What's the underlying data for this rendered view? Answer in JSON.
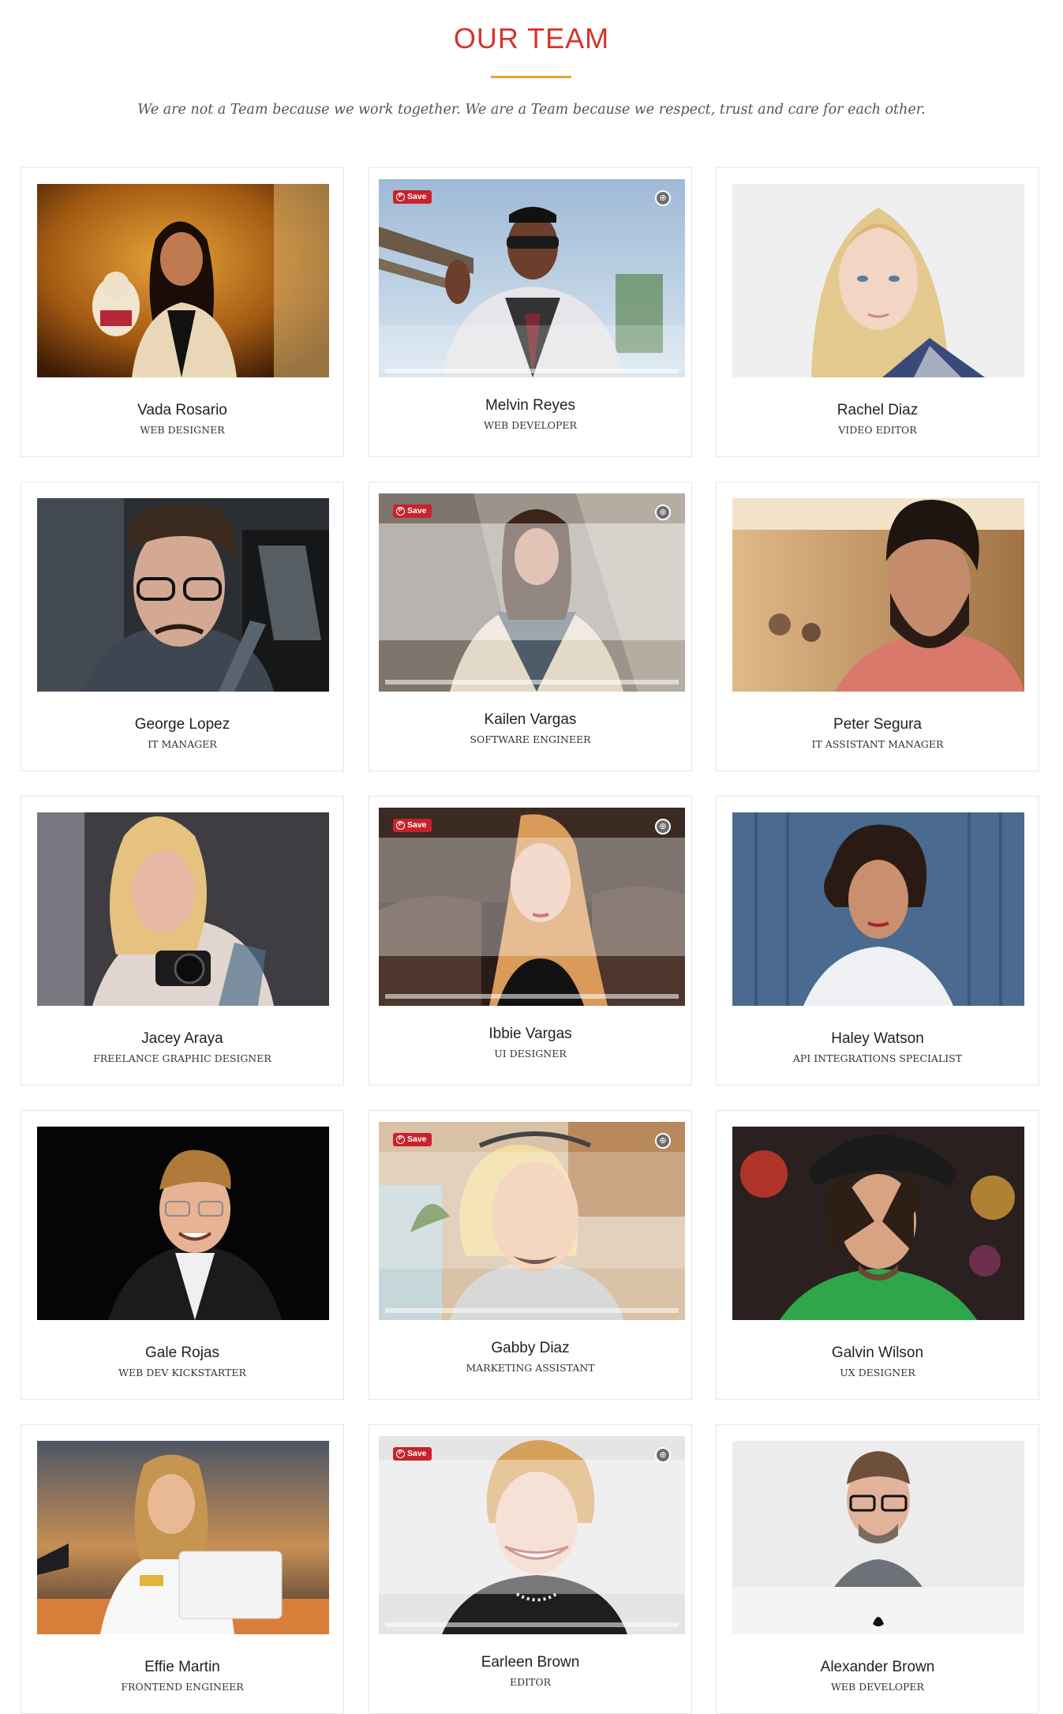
{
  "header": {
    "title": "OUR TEAM",
    "subtitle": "We are not a Team because we work together. We are a Team because we respect, trust and care for each other."
  },
  "hover_controls": {
    "save_label": "Save",
    "zoom_icon": "expand-icon"
  },
  "members": [
    {
      "name": "Vada Rosario",
      "role": "WEB DESIGNER"
    },
    {
      "name": "Melvin Reyes",
      "role": "WEB DEVELOPER"
    },
    {
      "name": "Rachel Diaz",
      "role": "VIDEO EDITOR"
    },
    {
      "name": "George Lopez",
      "role": "IT MANAGER"
    },
    {
      "name": "Kailen Vargas",
      "role": "SOFTWARE ENGINEER"
    },
    {
      "name": "Peter Segura",
      "role": "IT ASSISTANT MANAGER"
    },
    {
      "name": "Jacey Araya",
      "role": "FREELANCE GRAPHIC DESIGNER"
    },
    {
      "name": "Ibbie Vargas",
      "role": "UI DESIGNER"
    },
    {
      "name": "Haley Watson",
      "role": "API INTEGRATIONS SPECIALIST"
    },
    {
      "name": "Gale Rojas",
      "role": "WEB DEV KICKSTARTER"
    },
    {
      "name": "Gabby Diaz",
      "role": "MARKETING ASSISTANT"
    },
    {
      "name": "Galvin Wilson",
      "role": "UX DESIGNER"
    },
    {
      "name": "Effie Martin",
      "role": "FRONTEND ENGINEER"
    },
    {
      "name": "Earleen Brown",
      "role": "EDITOR"
    },
    {
      "name": "Alexander Brown",
      "role": "WEB DEVELOPER"
    }
  ],
  "colors": {
    "accent": "#d6332b",
    "divider": "#f39c33",
    "pinterest": "#c8232c"
  }
}
